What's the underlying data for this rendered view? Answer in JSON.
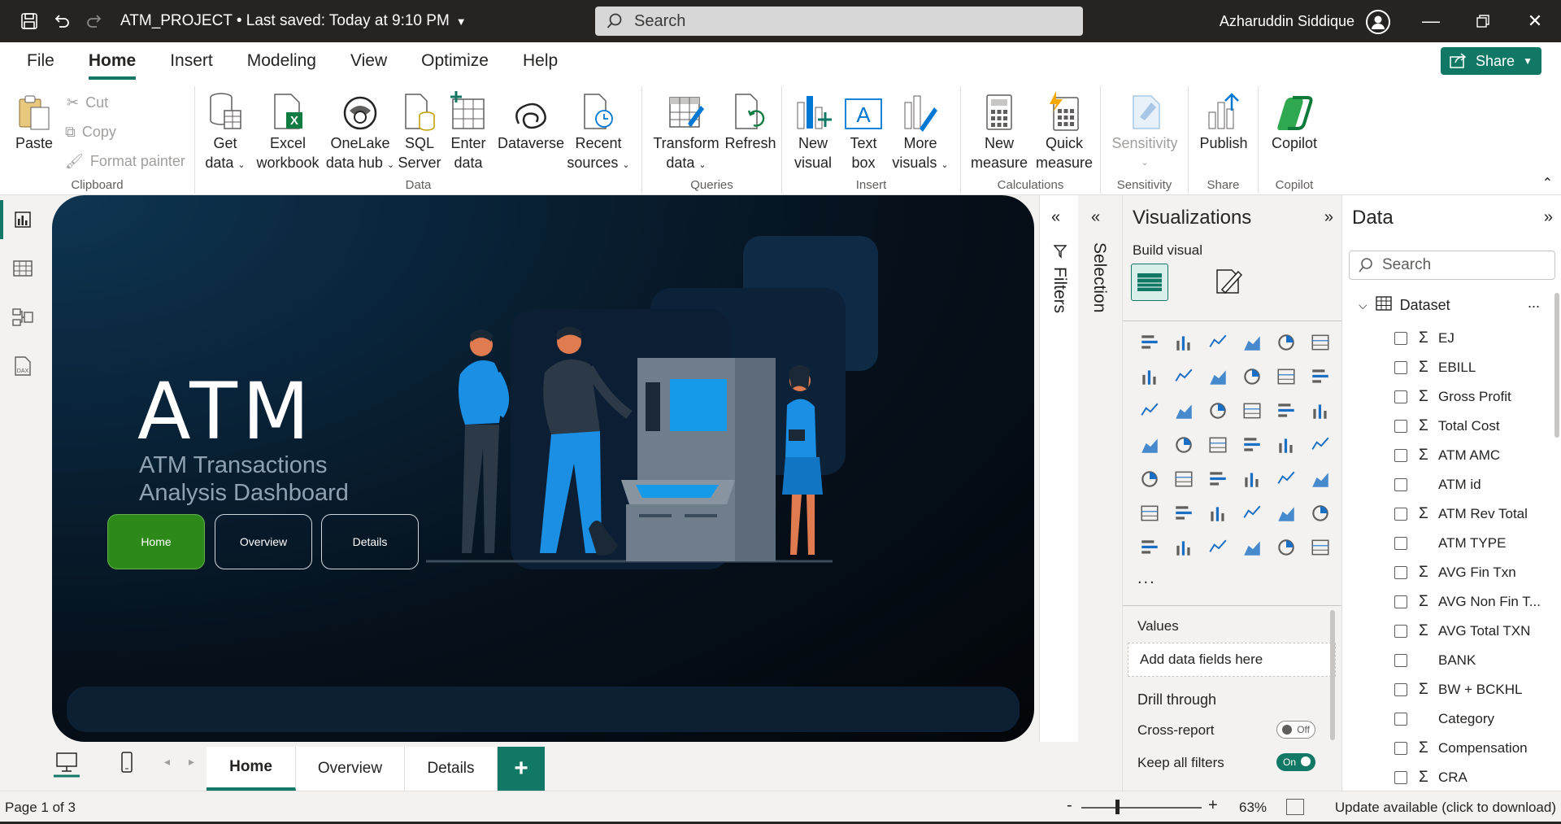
{
  "titlebar": {
    "doc_title": "ATM_PROJECT • Last saved: Today at 9:10 PM",
    "search_placeholder": "Search",
    "user_name": "Azharuddin Siddique"
  },
  "menu": {
    "tabs": [
      "File",
      "Home",
      "Insert",
      "Modeling",
      "View",
      "Optimize",
      "Help"
    ],
    "active": "Home",
    "share_label": "Share"
  },
  "ribbon": {
    "clipboard": {
      "label": "Clipboard",
      "paste": "Paste",
      "cut": "Cut",
      "copy": "Copy",
      "format_painter": "Format painter"
    },
    "data": {
      "label": "Data",
      "get_data_1": "Get",
      "get_data_2": "data",
      "excel_1": "Excel",
      "excel_2": "workbook",
      "onelake_1": "OneLake",
      "onelake_2": "data hub",
      "sql_1": "SQL",
      "sql_2": "Server",
      "enter_1": "Enter",
      "enter_2": "data",
      "dataverse": "Dataverse",
      "recent_1": "Recent",
      "recent_2": "sources"
    },
    "queries": {
      "label": "Queries",
      "transform_1": "Transform",
      "transform_2": "data",
      "refresh": "Refresh"
    },
    "insert": {
      "label": "Insert",
      "new_visual_1": "New",
      "new_visual_2": "visual",
      "text_box_1": "Text",
      "text_box_2": "box",
      "more_visuals_1": "More",
      "more_visuals_2": "visuals"
    },
    "calculations": {
      "label": "Calculations",
      "new_measure_1": "New",
      "new_measure_2": "measure",
      "quick_measure_1": "Quick",
      "quick_measure_2": "measure"
    },
    "sensitivity": {
      "label": "Sensitivity",
      "button": "Sensitivity"
    },
    "share": {
      "label": "Share",
      "publish": "Publish"
    },
    "copilot": {
      "label": "Copilot",
      "button": "Copilot"
    }
  },
  "report": {
    "logo_text": "ATM",
    "subtitle_line1": "ATM Transactions",
    "subtitle_line2": "Analysis Dashboard",
    "nav_buttons": [
      "Home",
      "Overview",
      "Details"
    ],
    "active_nav": "Home",
    "colors": {
      "accent_green": "#2d8a1a",
      "bg_dark": "#030609",
      "person_blue": "#1a8fe3"
    }
  },
  "page_tabs": {
    "tabs": [
      "Home",
      "Overview",
      "Details"
    ],
    "active": "Home",
    "add_label": "+"
  },
  "panes": {
    "filters_label": "Filters",
    "selection_label": "Selection",
    "visualizations": {
      "title": "Visualizations",
      "build_visual": "Build visual",
      "more": "...",
      "values_label": "Values",
      "values_placeholder": "Add data fields here",
      "drill_through": "Drill through",
      "cross_report": "Cross-report",
      "cross_report_state": "Off",
      "keep_all_filters": "Keep all filters",
      "keep_all_filters_state": "On"
    },
    "data": {
      "title": "Data",
      "search_placeholder": "Search",
      "dataset": "Dataset",
      "dataset_more": "...",
      "fields": [
        {
          "name": "EJ",
          "measure": true
        },
        {
          "name": "EBILL",
          "measure": true
        },
        {
          "name": "Gross Profit",
          "measure": true
        },
        {
          "name": "Total Cost",
          "measure": true
        },
        {
          "name": "ATM AMC",
          "measure": true
        },
        {
          "name": "ATM id",
          "measure": false
        },
        {
          "name": "ATM Rev Total",
          "measure": true
        },
        {
          "name": "ATM TYPE",
          "measure": false
        },
        {
          "name": "AVG Fin Txn",
          "measure": true
        },
        {
          "name": "AVG Non Fin T...",
          "measure": true
        },
        {
          "name": "AVG Total TXN",
          "measure": true
        },
        {
          "name": "BANK",
          "measure": false
        },
        {
          "name": "BW + BCKHL",
          "measure": true
        },
        {
          "name": "Category",
          "measure": false
        },
        {
          "name": "Compensation",
          "measure": true
        },
        {
          "name": "CRA",
          "measure": true
        }
      ]
    }
  },
  "status": {
    "page_count": "Page 1 of 3",
    "zoom": "63%",
    "zoom_fraction": 0.3,
    "update": "Update available (click to download)"
  },
  "brand_color": "#117865"
}
